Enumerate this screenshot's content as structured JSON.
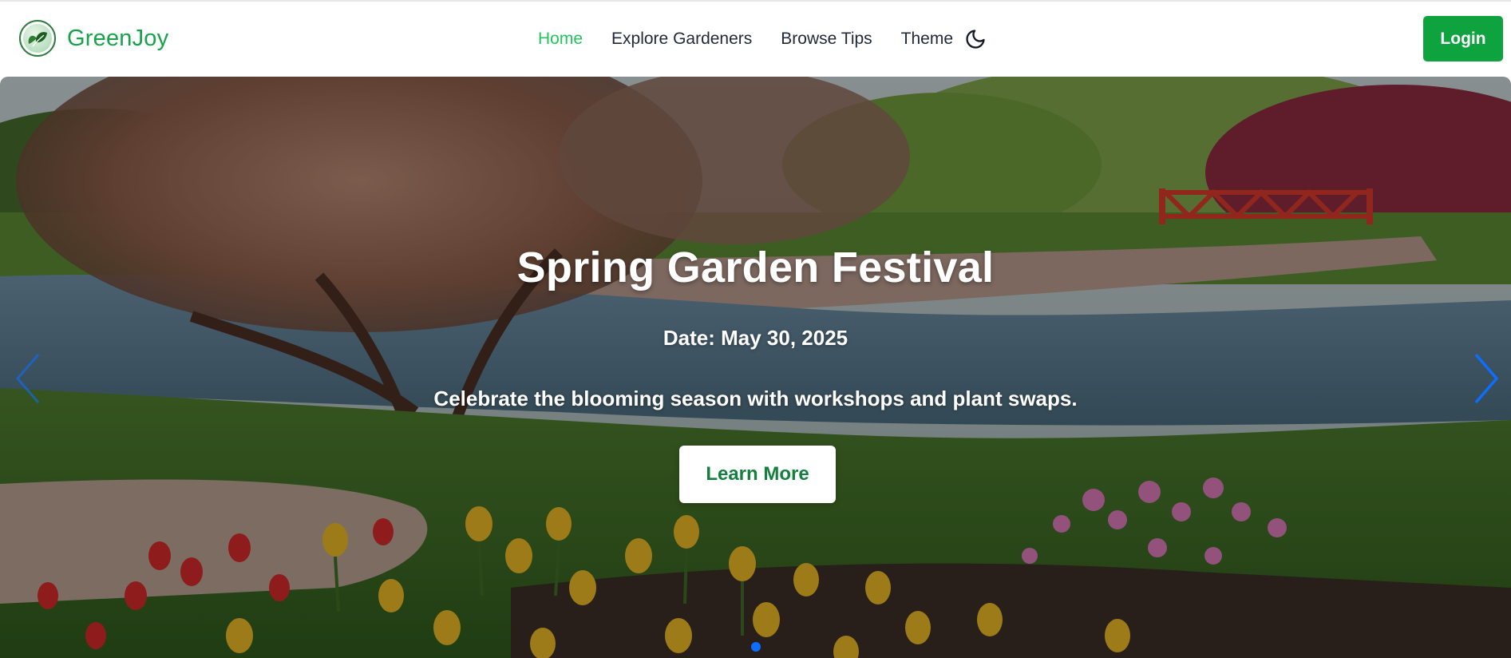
{
  "brand": {
    "name": "GreenJoy",
    "logo_icon": "leaf-logo-icon"
  },
  "nav": {
    "links": [
      {
        "label": "Home",
        "active": true
      },
      {
        "label": "Explore Gardeners",
        "active": false
      },
      {
        "label": "Browse Tips",
        "active": false
      }
    ],
    "theme_label": "Theme",
    "theme_icon": "moon-icon"
  },
  "login_label": "Login",
  "hero": {
    "title": "Spring Garden Festival",
    "date": "Date: May 30, 2025",
    "description": "Celebrate the blooming season with workshops and plant swaps.",
    "cta_label": "Learn More",
    "prev_icon": "chevron-left-icon",
    "next_icon": "chevron-right-icon",
    "active_slide": 1,
    "slide_count": 1
  },
  "colors": {
    "brand_green": "#16a34a",
    "active_link": "#22c55e",
    "login_bg": "#0fa33f",
    "cta_text": "#15803d",
    "arrow_blue": "#0d6efd",
    "dot_active": "#0d6efd"
  }
}
